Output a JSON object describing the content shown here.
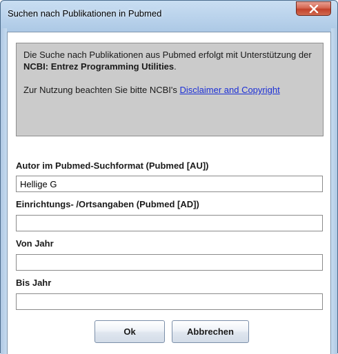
{
  "window": {
    "title": "Suchen nach Publikationen in Pubmed"
  },
  "info": {
    "line1_prefix": "Die Suche nach Publikationen aus Pubmed erfolgt mit Unterstützung der ",
    "line1_bold": "NCBI: Entrez Programming Utilities",
    "line1_suffix": ".",
    "line2_prefix": "Zur Nutzung beachten Sie bitte NCBI's ",
    "link_text": "Disclaimer and Copyright"
  },
  "fields": {
    "author_label": "Autor im Pubmed-Suchformat (Pubmed [AU])",
    "author_value": "Hellige G",
    "affiliation_label": "Einrichtungs- /Ortsangaben (Pubmed [AD])",
    "affiliation_value": "",
    "from_year_label": "Von Jahr",
    "from_year_value": "",
    "to_year_label": "Bis Jahr",
    "to_year_value": ""
  },
  "buttons": {
    "ok_label": "Ok",
    "cancel_label": "Abbrechen"
  },
  "colors": {
    "info_background": "#cbcbcb",
    "link": "#1b2fd6",
    "close_button": "#c2422b"
  }
}
